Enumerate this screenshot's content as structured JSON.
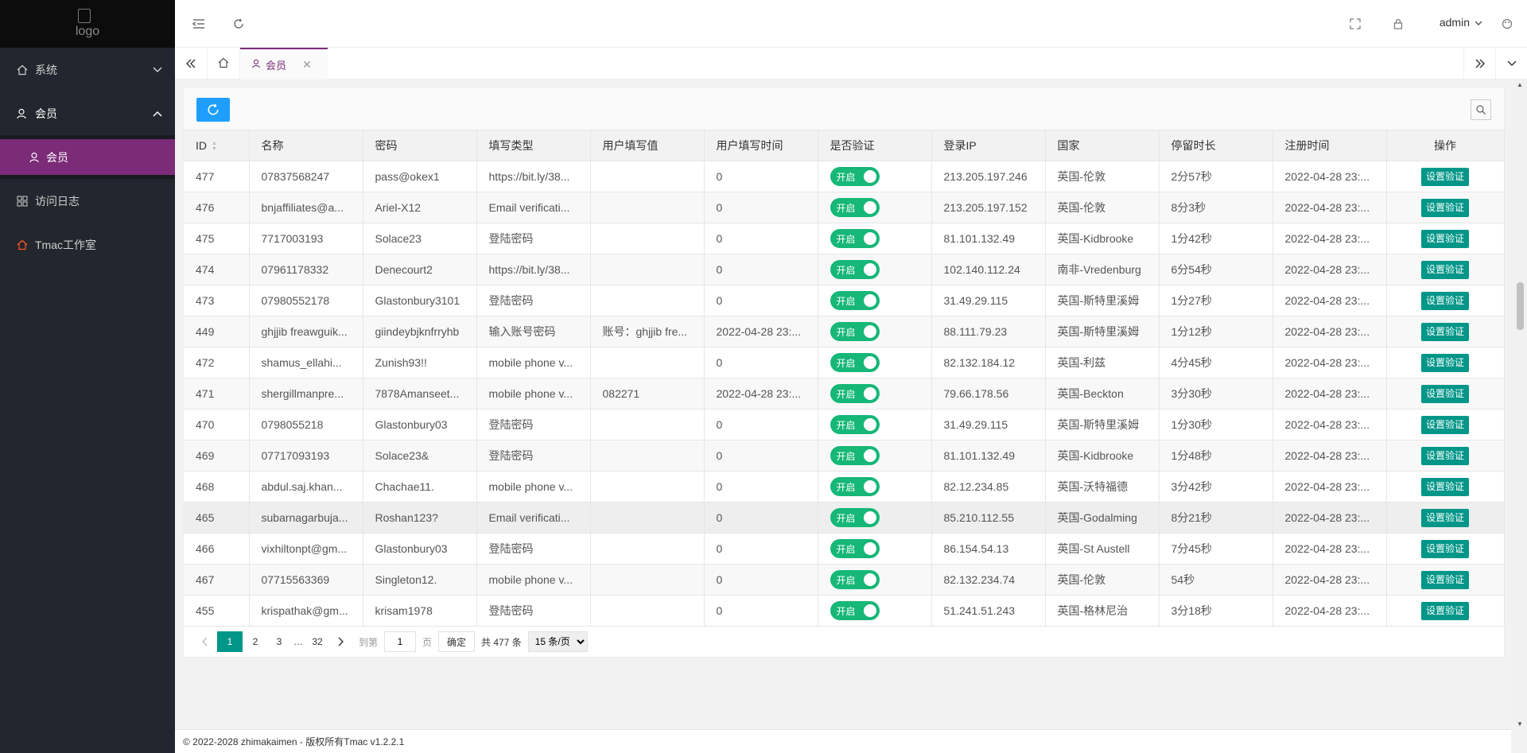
{
  "app": {
    "logo_alt": "logo",
    "footer": "© 2022-2028 zhimakaimen - 版权所有Tmac v1.2.2.1"
  },
  "sidebar": {
    "items": [
      {
        "label": "系统",
        "icon": "home-icon",
        "expanded": false
      },
      {
        "label": "会员",
        "icon": "user-icon",
        "expanded": true,
        "children": [
          {
            "label": "会员",
            "icon": "person-icon"
          }
        ]
      },
      {
        "label": "访问日志",
        "icon": "grid-icon"
      },
      {
        "label": "Tmac工作室",
        "icon": "home-red-icon"
      }
    ]
  },
  "header": {
    "user": "admin"
  },
  "tabs": {
    "active_label": "会员"
  },
  "table": {
    "columns": [
      "ID",
      "名称",
      "密码",
      "填写类型",
      "用户填写值",
      "用户填写时间",
      "是否验证",
      "登录IP",
      "国家",
      "停留时长",
      "注册时间",
      "操作"
    ],
    "switch_label": "开启",
    "action_label": "设置验证",
    "rows": [
      [
        "477",
        "07837568247",
        "pass@okex1",
        "https://bit.ly/38...",
        "",
        "0",
        "213.205.197.246",
        "英国-伦敦",
        "2分57秒",
        "2022-04-28 23:..."
      ],
      [
        "476",
        "bnjaffiliates@a...",
        "Ariel-X12",
        "Email verificati...",
        "",
        "0",
        "213.205.197.152",
        "英国-伦敦",
        "8分3秒",
        "2022-04-28 23:..."
      ],
      [
        "475",
        "7717003193",
        "Solace23",
        "登陆密码",
        "",
        "0",
        "81.101.132.49",
        "英国-Kidbrooke",
        "1分42秒",
        "2022-04-28 23:..."
      ],
      [
        "474",
        "07961178332",
        "Denecourt2",
        "https://bit.ly/38...",
        "",
        "0",
        "102.140.112.24",
        "南非-Vredenburg",
        "6分54秒",
        "2022-04-28 23:..."
      ],
      [
        "473",
        "07980552178",
        "Glastonbury3101",
        "登陆密码",
        "",
        "0",
        "31.49.29.115",
        "英国-斯特里溪姆",
        "1分27秒",
        "2022-04-28 23:..."
      ],
      [
        "449",
        "ghjjib freawguik...",
        "giindeybjknfrryhb",
        "输入账号密码",
        "账号：ghjjib fre...",
        "2022-04-28 23:...",
        "88.111.79.23",
        "英国-斯特里溪姆",
        "1分12秒",
        "2022-04-28 23:..."
      ],
      [
        "472",
        "shamus_ellahi...",
        "Zunish93!!",
        "mobile phone v...",
        "",
        "0",
        "82.132.184.12",
        "英国-利兹",
        "4分45秒",
        "2022-04-28 23:..."
      ],
      [
        "471",
        "shergillmanpre...",
        "7878Amanseet...",
        "mobile phone v...",
        "082271",
        "2022-04-28 23:...",
        "79.66.178.56",
        "英国-Beckton",
        "3分30秒",
        "2022-04-28 23:..."
      ],
      [
        "470",
        "0798055218",
        "Glastonbury03",
        "登陆密码",
        "",
        "0",
        "31.49.29.115",
        "英国-斯特里溪姆",
        "1分30秒",
        "2022-04-28 23:..."
      ],
      [
        "469",
        "07717093193",
        "Solace23&",
        "登陆密码",
        "",
        "0",
        "81.101.132.49",
        "英国-Kidbrooke",
        "1分48秒",
        "2022-04-28 23:..."
      ],
      [
        "468",
        "abdul.saj.khan...",
        "Chachae11.",
        "mobile phone v...",
        "",
        "0",
        "82.12.234.85",
        "英国-沃特福德",
        "3分42秒",
        "2022-04-28 23:..."
      ],
      [
        "465",
        "subarnagarbuja...",
        "Roshan123?",
        "Email verificati...",
        "",
        "0",
        "85.210.112.55",
        "英国-Godalming",
        "8分21秒",
        "2022-04-28 23:..."
      ],
      [
        "466",
        "vixhiltonpt@gm...",
        "Glastonbury03",
        "登陆密码",
        "",
        "0",
        "86.154.54.13",
        "英国-St Austell",
        "7分45秒",
        "2022-04-28 23:..."
      ],
      [
        "467",
        "07715563369",
        "Singleton12.",
        "mobile phone v...",
        "",
        "0",
        "82.132.234.74",
        "英国-伦敦",
        "54秒",
        "2022-04-28 23:..."
      ],
      [
        "455",
        "krispathak@gm...",
        "krisam1978",
        "登陆密码",
        "",
        "0",
        "51.241.51.243",
        "英国-格林尼治",
        "3分18秒",
        "2022-04-28 23:..."
      ]
    ]
  },
  "pager": {
    "pages": [
      "1",
      "2",
      "3",
      "…",
      "32"
    ],
    "current": "1",
    "goto_label": "到第",
    "goto_value": "1",
    "page_unit": "页",
    "confirm": "确定",
    "total": "共 477 条",
    "per_page": "15 条/页"
  },
  "colors": {
    "sidebar": "#23262e",
    "active_menu": "#7b2b77",
    "primary": "#1e9fff",
    "teal": "#009688",
    "switch": "#16b777"
  }
}
